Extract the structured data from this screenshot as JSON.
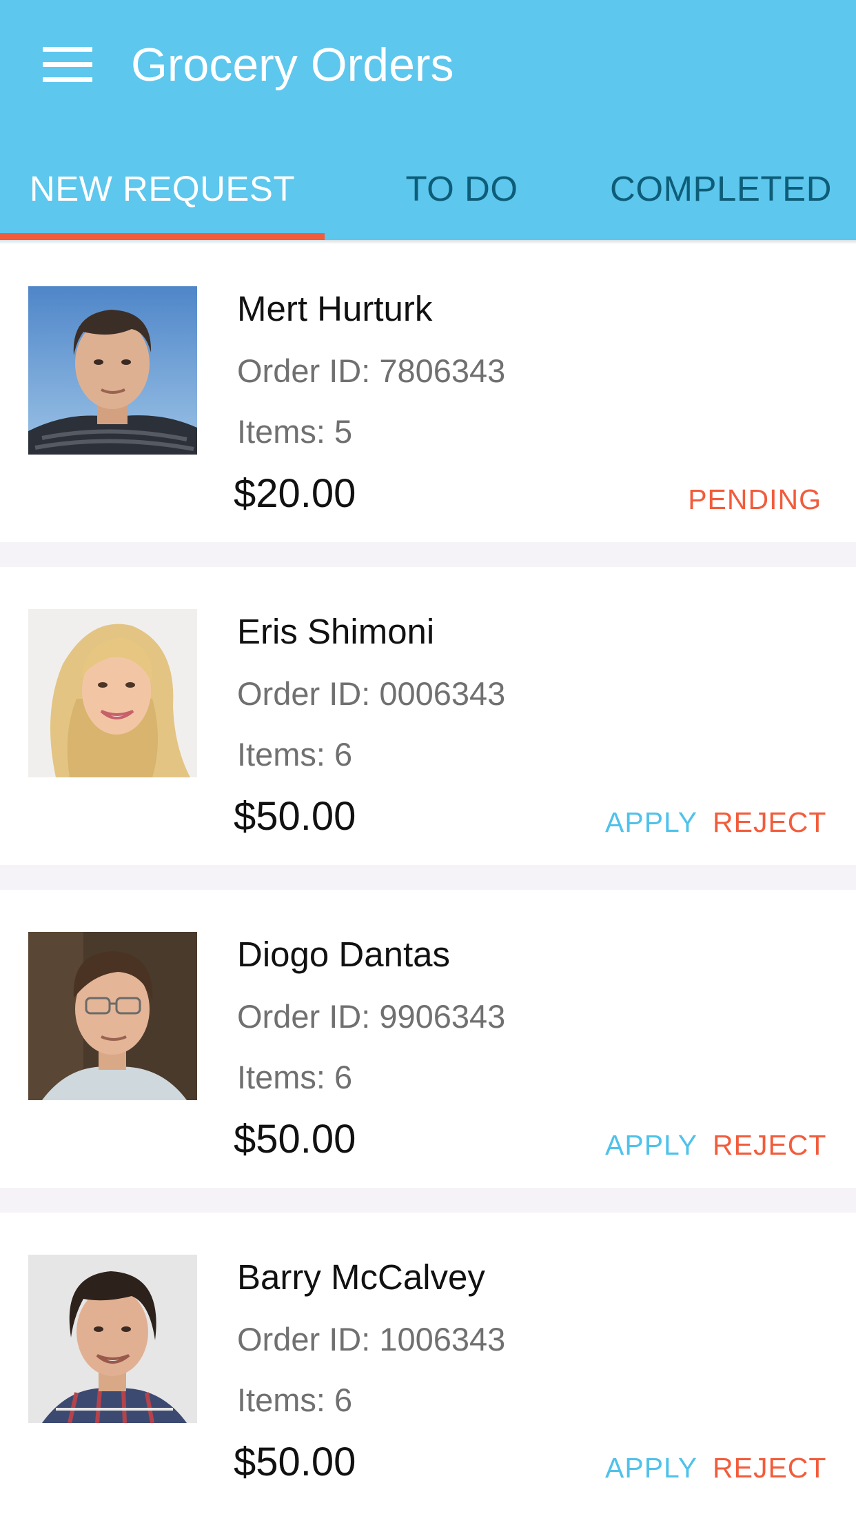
{
  "app_bar": {
    "title": "Grocery Orders",
    "menu_icon": "hamburger-menu-icon",
    "background_color": "#5dc7ee"
  },
  "tabs": [
    {
      "label": "NEW REQUEST",
      "selected": true
    },
    {
      "label": "TO DO",
      "selected": false
    },
    {
      "label": "COMPLETED",
      "selected": false
    }
  ],
  "accent_color": "#f25c3b",
  "orders": [
    {
      "name": "Mert Hurturk",
      "order_id": "Order ID: 7806343",
      "items": "Items: 5",
      "price": "$20.00",
      "status": "PENDING"
    },
    {
      "name": "Eris Shimoni",
      "order_id": "Order ID: 0006343",
      "items": "Items: 6",
      "price": "$50.00",
      "apply_label": "APPLY",
      "reject_label": "REJECT"
    },
    {
      "name": "Diogo Dantas",
      "order_id": "Order ID: 9906343",
      "items": "Items: 6",
      "price": "$50.00",
      "apply_label": "APPLY",
      "reject_label": "REJECT"
    },
    {
      "name": "Barry McCalvey",
      "order_id": "Order ID: 1006343",
      "items": "Items: 6",
      "price": "$50.00",
      "apply_label": "APPLY",
      "reject_label": "REJECT"
    }
  ]
}
